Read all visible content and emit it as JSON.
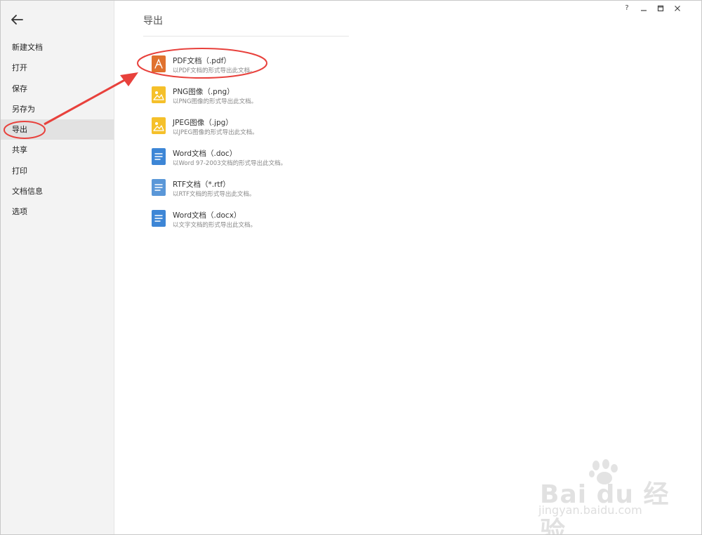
{
  "sidebar": {
    "menu": [
      {
        "label": "新建文档"
      },
      {
        "label": "打开"
      },
      {
        "label": "保存"
      },
      {
        "label": "另存为"
      },
      {
        "label": "导出"
      },
      {
        "label": "共享"
      },
      {
        "label": "打印"
      },
      {
        "label": "文档信息"
      },
      {
        "label": "选项"
      }
    ],
    "active": "导出"
  },
  "main": {
    "title": "导出",
    "exports": [
      {
        "name": "PDF文档（.pdf）",
        "desc": "以PDF文档的形式导出此文档。",
        "icon": "pdf-icon",
        "color": "#e0712e"
      },
      {
        "name": "PNG图像（.png）",
        "desc": "以PNG图像的形式导出此文档。",
        "icon": "image-icon",
        "color": "#f5c02a"
      },
      {
        "name": "JPEG图像（.jpg）",
        "desc": "以JPEG图像的形式导出此文档。",
        "icon": "image-icon",
        "color": "#f5c02a"
      },
      {
        "name": "Word文档（.doc）",
        "desc": "以Word 97-2003文档的形式导出此文档。",
        "icon": "word-doc-icon",
        "color": "#3d86d6"
      },
      {
        "name": "RTF文档（*.rtf）",
        "desc": "以RTF文档的形式导出此文档。",
        "icon": "rtf-doc-icon",
        "color": "#5a97d8"
      },
      {
        "name": "Word文档（.docx）",
        "desc": "以文字文档的形式导出此文档。",
        "icon": "word-doc-icon",
        "color": "#3d86d6"
      }
    ]
  },
  "window_controls": {
    "help": "?"
  },
  "watermark": {
    "brand": "Bai du 经验",
    "sub": "jingyan.baidu.com"
  },
  "colors": {
    "annotation": "#e8413c",
    "sidebar_bg": "#f3f3f3",
    "active_bg": "#e2e2e2"
  }
}
